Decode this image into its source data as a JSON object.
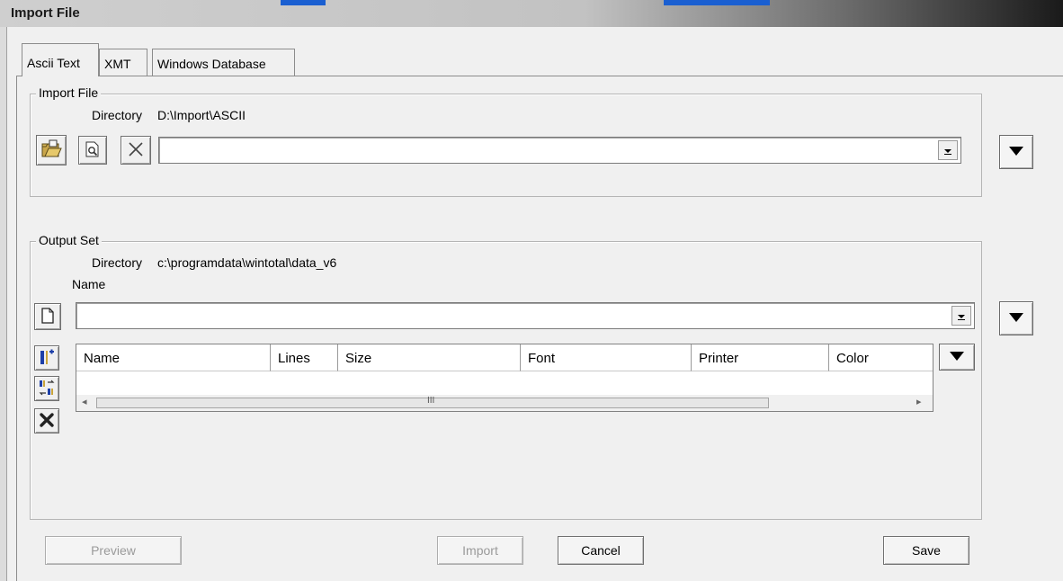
{
  "window": {
    "title": "Import File"
  },
  "colors": {
    "title_bar_dark": "#1a1a1a",
    "link_blue": "#1a5fd1",
    "face": "#f0f0f0"
  },
  "tabs": [
    {
      "label": "Ascii Text",
      "active": true
    },
    {
      "label": "XMT",
      "active": false
    },
    {
      "label": "Windows Database",
      "active": false
    }
  ],
  "import_file": {
    "group_label": "Import File",
    "directory_label": "Directory",
    "directory_value": "D:\\Import\\ASCII",
    "tools": [
      "open-folder-icon",
      "preview-icon",
      "clear-icon"
    ],
    "file_combo_value": ""
  },
  "output_set": {
    "group_label": "Output Set",
    "directory_label": "Directory",
    "directory_value": "c:\\programdata\\wintotal\\data_v6",
    "name_label": "Name",
    "name_combo_value": "",
    "tools": [
      "new-document-icon",
      "add-column-icon",
      "column-settings-icon",
      "delete-icon"
    ]
  },
  "table": {
    "columns": [
      "Name",
      "Lines",
      "Size",
      "Font",
      "Printer",
      "Color"
    ],
    "rows": [],
    "scroll_grip": "III"
  },
  "buttons": {
    "preview": "Preview",
    "import": "Import",
    "cancel": "Cancel",
    "save": "Save"
  }
}
